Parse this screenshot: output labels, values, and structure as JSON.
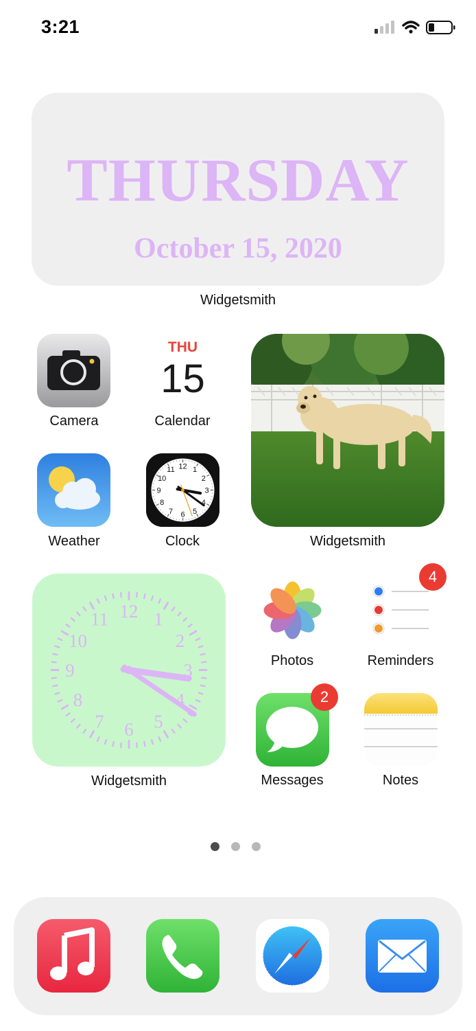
{
  "status_bar": {
    "time": "3:21",
    "icons": [
      "cellular-signal-icon",
      "wifi-icon",
      "battery-icon"
    ]
  },
  "date_widget": {
    "day": "THURSDAY",
    "date": "October 15, 2020",
    "accent_color": "#dcb5f6",
    "label": "Widgetsmith"
  },
  "apps": {
    "camera": {
      "label": "Camera"
    },
    "calendar": {
      "label": "Calendar",
      "weekday": "THU",
      "day": "15",
      "weekday_color": "#e8433b"
    },
    "weather": {
      "label": "Weather"
    },
    "clock": {
      "label": "Clock",
      "numerals": [
        "12",
        "1",
        "2",
        "3",
        "4",
        "5",
        "6",
        "7",
        "8",
        "9",
        "10",
        "11"
      ]
    },
    "photos": {
      "label": "Photos"
    },
    "reminders": {
      "label": "Reminders",
      "badge": "4"
    },
    "messages": {
      "label": "Messages",
      "badge": "2"
    },
    "notes": {
      "label": "Notes"
    }
  },
  "photo_widget": {
    "label": "Widgetsmith"
  },
  "clock_widget": {
    "label": "Widgetsmith",
    "background": "#c9f7cc",
    "accent_color": "#dcb5f6",
    "numerals": [
      "12",
      "1",
      "2",
      "3",
      "4",
      "5",
      "6",
      "7",
      "8",
      "9",
      "10",
      "11"
    ]
  },
  "page_indicator": {
    "pages": 3,
    "current": 1
  },
  "dock": {
    "apps": [
      "music-icon",
      "phone-icon",
      "safari-icon",
      "mail-icon"
    ]
  }
}
